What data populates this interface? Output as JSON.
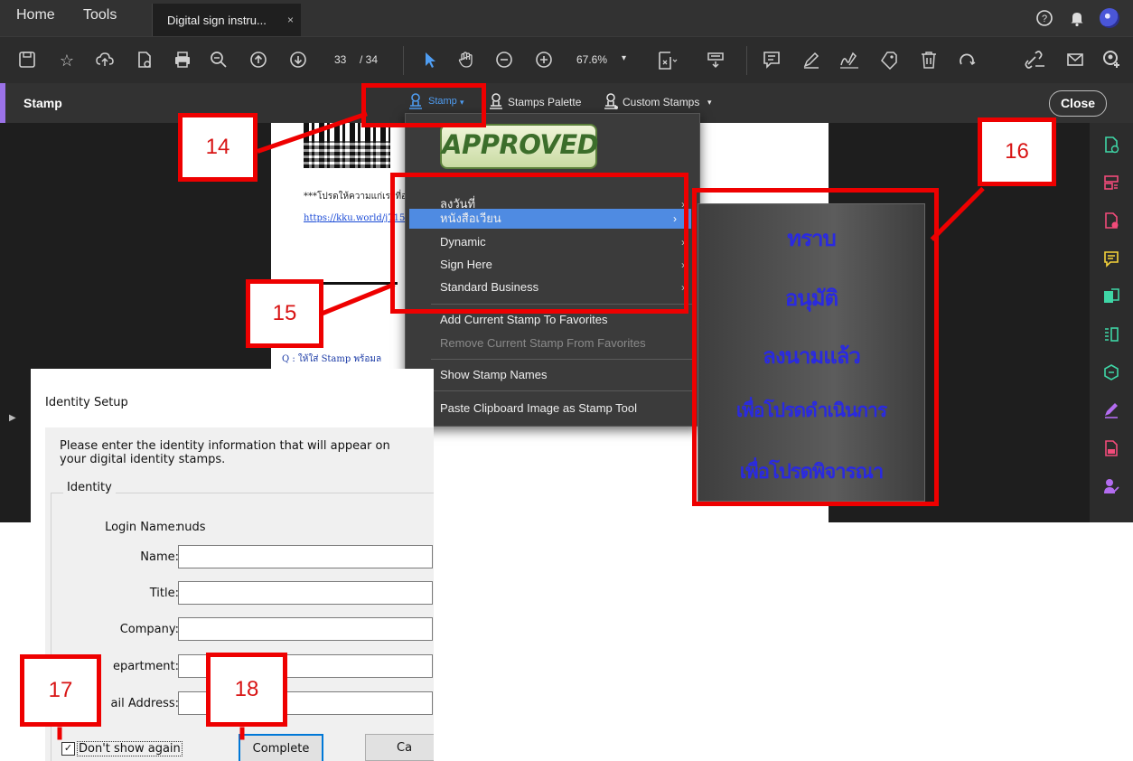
{
  "topbar": {
    "menu_home": "Home",
    "menu_tools": "Tools",
    "tab_title": "Digital sign instru...",
    "tab_close": "×",
    "help_icon": "?",
    "notif_icon": "bell-icon"
  },
  "toolbar": {
    "page_current": "33",
    "page_total": "/ 34",
    "zoom": "67.6%"
  },
  "stampbar": {
    "label": "Stamp",
    "stamp_menu": "Stamp",
    "stamps_palette": "Stamps Palette",
    "custom_stamps": "Custom Stamps",
    "close": "Close"
  },
  "page": {
    "line1": "***โปรดให้ความแก่เราที่อ",
    "link": "https://kku.world/j715",
    "q": "Q : ให้ใส่ Stamp พร้อมล"
  },
  "dropdown": {
    "approved": "APPROVED",
    "items": [
      {
        "label": "ลงวันที่"
      },
      {
        "label": "หนังสือเวียน"
      },
      {
        "label": "Dynamic"
      },
      {
        "label": "Sign Here"
      },
      {
        "label": "Standard Business"
      }
    ],
    "add_fav": "Add Current Stamp To Favorites",
    "remove_fav": "Remove Current Stamp From Favorites",
    "show_names": "Show Stamp Names",
    "paste_clip": "Paste Clipboard Image as Stamp Tool"
  },
  "submenu": {
    "items": [
      "ทราบ",
      "อนุมัติ",
      "ลงนามแล้ว",
      "เพื่อโปรดดำเนินการ",
      "เพื่อโปรดพิจารณา"
    ]
  },
  "annotations": {
    "n14": "14",
    "n15": "15",
    "n16": "16",
    "n17": "17",
    "n18": "18"
  },
  "dialog": {
    "title": "Identity Setup",
    "intro": "Please enter the identity information that will appear on your digital identity stamps.",
    "legend": "Identity",
    "login_label": "Login Name:",
    "login_value": "nuds",
    "name_label": "Name:",
    "title_label": "Title:",
    "company_label": "Company:",
    "department_label": "epartment:",
    "email_label": "ail Address:",
    "dont_show": "Don't show again",
    "complete": "Complete",
    "cancel": "Ca"
  },
  "colors": {
    "accent_purple": "#9b72e8",
    "annotation_red": "#ee0000",
    "selection_blue": "#4f8be2",
    "stamp_text_blue": "#2a2ae0",
    "approved_green": "#3c6e2b"
  }
}
